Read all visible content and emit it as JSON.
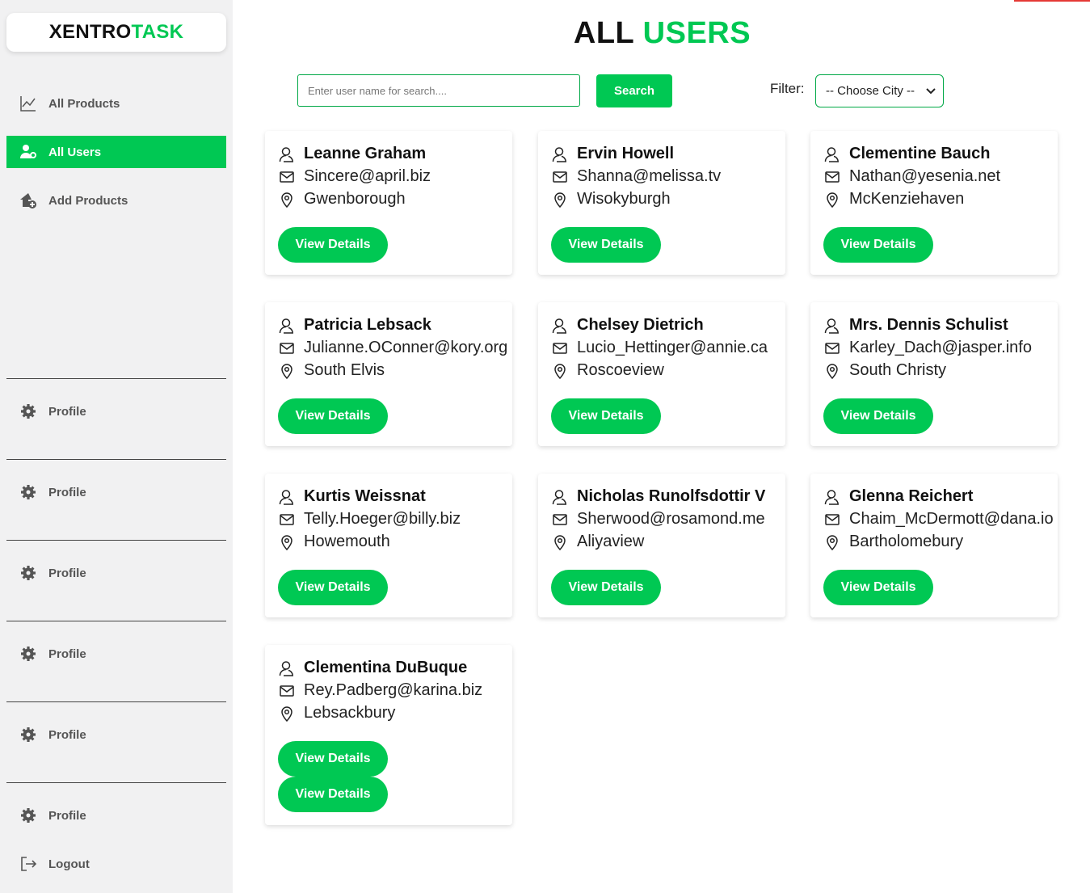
{
  "brand": {
    "part1": "XENTRO",
    "part2": "TASK"
  },
  "sidebar": {
    "items": [
      {
        "label": "All Products",
        "icon": "chart-line-icon"
      },
      {
        "label": "All Users",
        "icon": "users-cog-icon",
        "active": true
      },
      {
        "label": "Add Products",
        "icon": "house-plus-icon"
      }
    ],
    "profile_items": [
      "Profile",
      "Profile",
      "Profile",
      "Profile",
      "Profile",
      "Profile"
    ],
    "logout": "Logout"
  },
  "header": {
    "title_part1": "ALL",
    "title_part2": "USERS"
  },
  "search": {
    "placeholder": "Enter user name for search....",
    "value": "",
    "button": "Search"
  },
  "filter": {
    "label": "Filter:",
    "selected": "-- Choose City --"
  },
  "colors": {
    "accent": "#00c853",
    "sidebar_bg": "#f1f1f2",
    "top_accent": "#e53935"
  },
  "users": [
    {
      "name": "Leanne Graham",
      "email": "Sincere@april.biz",
      "city": "Gwenborough",
      "button": "View Details"
    },
    {
      "name": "Ervin Howell",
      "email": "Shanna@melissa.tv",
      "city": "Wisokyburgh",
      "button": "View Details"
    },
    {
      "name": "Clementine Bauch",
      "email": "Nathan@yesenia.net",
      "city": "McKenziehaven",
      "button": "View Details"
    },
    {
      "name": "Patricia Lebsack",
      "email": "Julianne.OConner@kory.org",
      "city": "South Elvis",
      "button": "View Details"
    },
    {
      "name": "Chelsey Dietrich",
      "email": "Lucio_Hettinger@annie.ca",
      "city": "Roscoeview",
      "button": "View Details"
    },
    {
      "name": "Mrs. Dennis Schulist",
      "email": "Karley_Dach@jasper.info",
      "city": "South Christy",
      "button": "View Details"
    },
    {
      "name": "Kurtis Weissnat",
      "email": "Telly.Hoeger@billy.biz",
      "city": "Howemouth",
      "button": "View Details"
    },
    {
      "name": "Nicholas Runolfsdottir V",
      "email": "Sherwood@rosamond.me",
      "city": "Aliyaview",
      "button": "View Details"
    },
    {
      "name": "Glenna Reichert",
      "email": "Chaim_McDermott@dana.io",
      "city": "Bartholomebury",
      "button": "View Details"
    },
    {
      "name": "Clementina DuBuque",
      "email": "Rey.Padberg@karina.biz",
      "city": "Lebsackbury",
      "button": "View Details",
      "button2": "View Details"
    }
  ]
}
